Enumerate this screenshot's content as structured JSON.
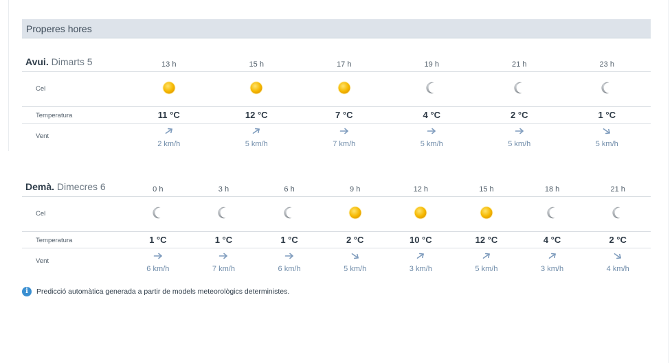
{
  "panel": {
    "title": "Properes hores"
  },
  "labels": {
    "sky": "Cel",
    "temperature": "Temperatura",
    "wind": "Vent"
  },
  "days": [
    {
      "name": "Avui.",
      "date": "Dimarts 5",
      "hours": [
        {
          "hour": "13 h",
          "sky": "sun-icon",
          "temp": "11 °C",
          "wind_dir": "north-east-arrow",
          "wind": "2 km/h"
        },
        {
          "hour": "15 h",
          "sky": "sun-icon",
          "temp": "12 °C",
          "wind_dir": "north-east-arrow",
          "wind": "5 km/h"
        },
        {
          "hour": "17 h",
          "sky": "sun-icon",
          "temp": "7 °C",
          "wind_dir": "east-arrow",
          "wind": "7 km/h"
        },
        {
          "hour": "19 h",
          "sky": "moon-icon",
          "temp": "4 °C",
          "wind_dir": "east-arrow",
          "wind": "5 km/h"
        },
        {
          "hour": "21 h",
          "sky": "moon-icon",
          "temp": "2 °C",
          "wind_dir": "east-arrow",
          "wind": "5 km/h"
        },
        {
          "hour": "23 h",
          "sky": "moon-icon",
          "temp": "1 °C",
          "wind_dir": "south-east-arrow",
          "wind": "5 km/h"
        }
      ]
    },
    {
      "name": "Demà.",
      "date": "Dimecres 6",
      "hours": [
        {
          "hour": "0 h",
          "sky": "moon-icon",
          "temp": "1 °C",
          "wind_dir": "east-arrow",
          "wind": "6 km/h"
        },
        {
          "hour": "3 h",
          "sky": "moon-icon",
          "temp": "1 °C",
          "wind_dir": "east-arrow",
          "wind": "7 km/h"
        },
        {
          "hour": "6 h",
          "sky": "moon-icon",
          "temp": "1 °C",
          "wind_dir": "east-arrow",
          "wind": "6 km/h"
        },
        {
          "hour": "9 h",
          "sky": "sun-icon",
          "temp": "2 °C",
          "wind_dir": "south-east-arrow",
          "wind": "5 km/h"
        },
        {
          "hour": "12 h",
          "sky": "sun-icon",
          "temp": "10 °C",
          "wind_dir": "north-east-arrow",
          "wind": "3 km/h"
        },
        {
          "hour": "15 h",
          "sky": "sun-icon",
          "temp": "12 °C",
          "wind_dir": "north-east-arrow",
          "wind": "5 km/h"
        },
        {
          "hour": "18 h",
          "sky": "moon-icon",
          "temp": "4 °C",
          "wind_dir": "north-east-arrow",
          "wind": "3 km/h"
        },
        {
          "hour": "21 h",
          "sky": "moon-icon",
          "temp": "2 °C",
          "wind_dir": "south-east-arrow",
          "wind": "4 km/h"
        }
      ]
    }
  ],
  "note": {
    "icon": "info-icon",
    "text": "Predicció automàtica generada a partir de models meteorològics deterministes."
  },
  "colors": {
    "header_bg": "#dde3ea",
    "sun": "#f5b800",
    "moon": "#9da3a8",
    "wind_arrow": "#7f9cbd",
    "info": "#3a8fd1"
  }
}
